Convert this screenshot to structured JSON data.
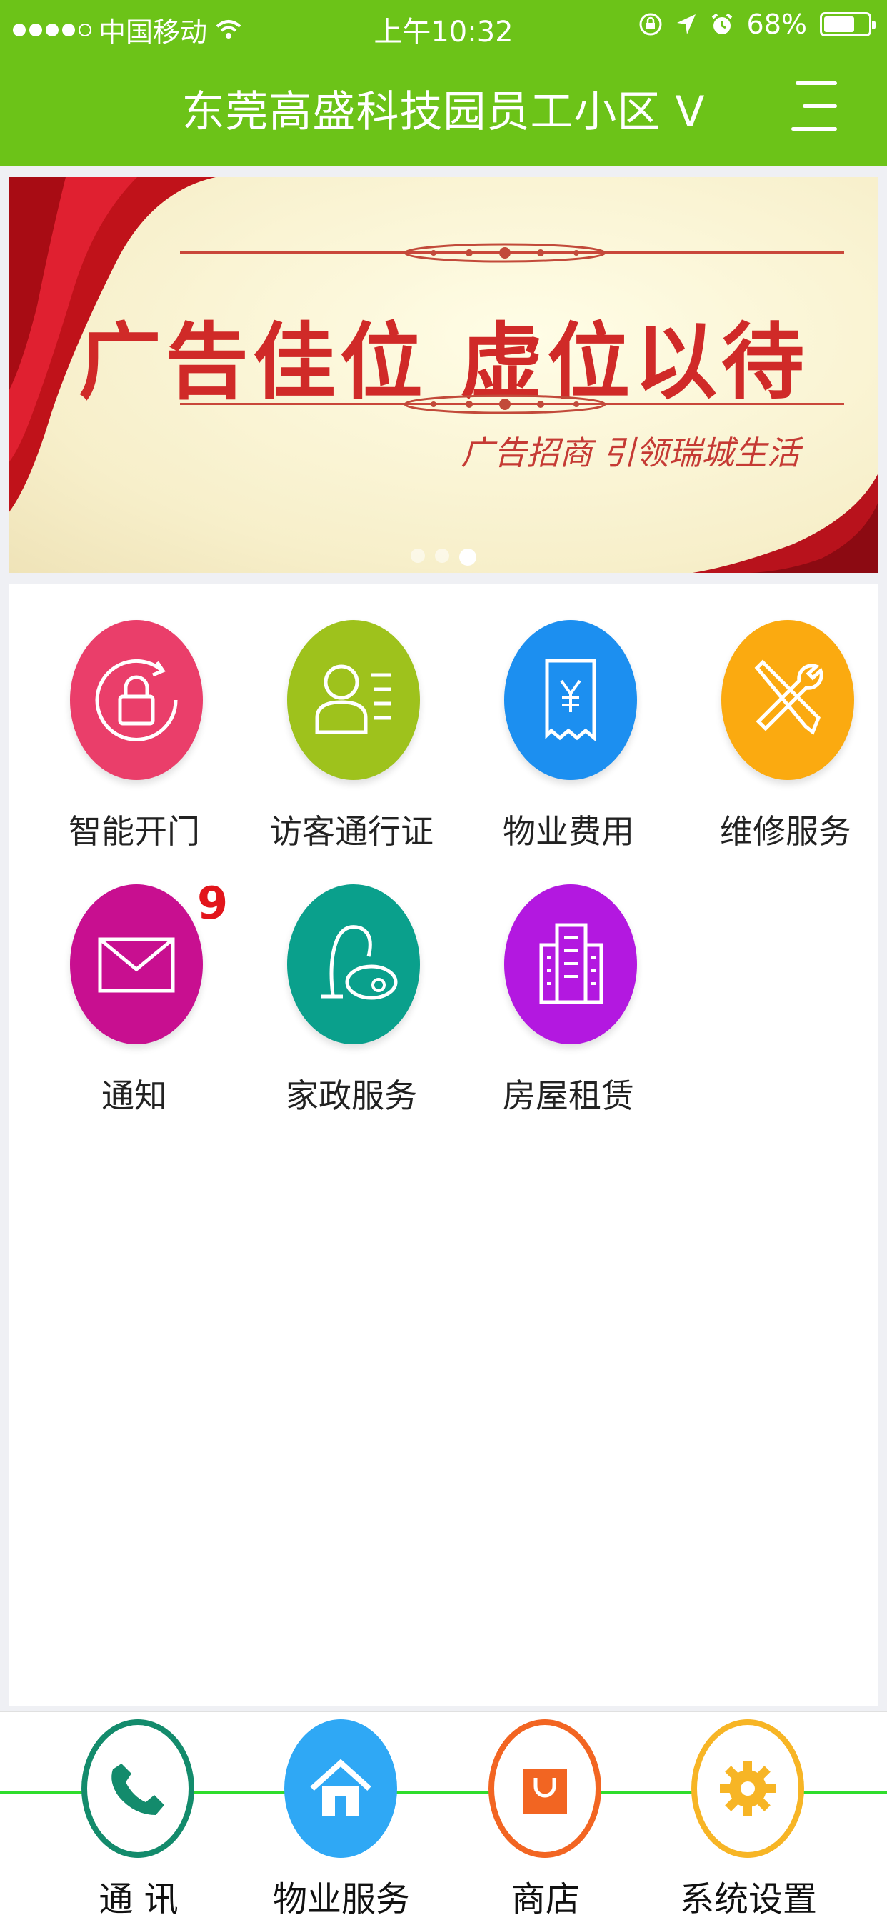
{
  "status_bar": {
    "carrier": "中国移动",
    "time": "上午10:32",
    "battery": "68%",
    "battery_level": 0.68
  },
  "header": {
    "title": "东莞高盛科技园员工小区 V",
    "menu_icon": "hamburger-menu-icon"
  },
  "banner": {
    "headline": "广告佳位  虚位以待",
    "subline": "广告招商   引领瑞城生活",
    "slide_count": 3,
    "active_slide": 3
  },
  "services": [
    {
      "label": "智能开门",
      "icon": "door-lock-icon",
      "color": "#ea3e6a"
    },
    {
      "label": "访客通行证",
      "icon": "visitor-pass-icon",
      "color": "#9ec21c"
    },
    {
      "label": "物业费用",
      "icon": "bill-icon",
      "color": "#1c8ff0"
    },
    {
      "label": "维修服务",
      "icon": "tools-icon",
      "color": "#fbaa10"
    },
    {
      "label": "通知",
      "icon": "envelope-icon",
      "color": "#c80f90",
      "badge": "9"
    },
    {
      "label": "家政服务",
      "icon": "vacuum-icon",
      "color": "#0aa08c"
    },
    {
      "label": "房屋租赁",
      "icon": "building-icon",
      "color": "#b318e0"
    }
  ],
  "bottom_nav": [
    {
      "label": "通 讯",
      "icon": "phone-icon",
      "color": "#138b6c"
    },
    {
      "label": "物业服务",
      "icon": "home-icon",
      "color": "#2fa8f5"
    },
    {
      "label": "商店",
      "icon": "shopping-bag-icon",
      "color": "#f26522"
    },
    {
      "label": "系统设置",
      "icon": "gear-icon",
      "color": "#f7b525"
    }
  ]
}
